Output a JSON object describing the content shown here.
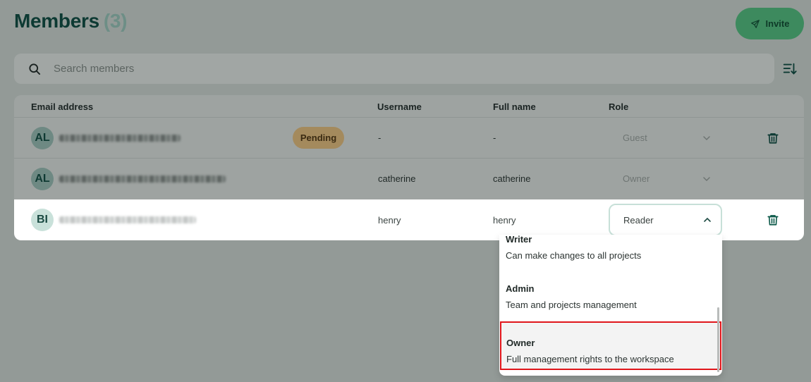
{
  "header": {
    "title": "Members",
    "count": "(3)",
    "invite_label": "Invite"
  },
  "search": {
    "placeholder": "Search members"
  },
  "table": {
    "columns": {
      "email": "Email address",
      "username": "Username",
      "fullname": "Full name",
      "role": "Role"
    },
    "rows": [
      {
        "initials": "AL",
        "badge": "Pending",
        "username": "-",
        "fullname": "-",
        "role": "Guest"
      },
      {
        "initials": "AL",
        "username": "catherine",
        "fullname": "catherine",
        "role": "Owner"
      },
      {
        "initials": "BI",
        "username": "henry",
        "fullname": "henry",
        "role": "Reader"
      }
    ]
  },
  "dropdown": {
    "options": [
      {
        "name": "Writer",
        "description": "Can make changes to all projects"
      },
      {
        "name": "Admin",
        "description": "Team and projects management"
      },
      {
        "name": "Owner",
        "description": "Full management rights to the workspace"
      }
    ]
  },
  "icons": {
    "invite": "send-icon",
    "search": "search-icon",
    "sort": "sort-icon",
    "chevron": "chevron-icon",
    "delete": "trash-icon"
  },
  "colors": {
    "accent": "#3d8a5e",
    "highlight_border": "#e0161b",
    "pending": "#a48a5d"
  }
}
